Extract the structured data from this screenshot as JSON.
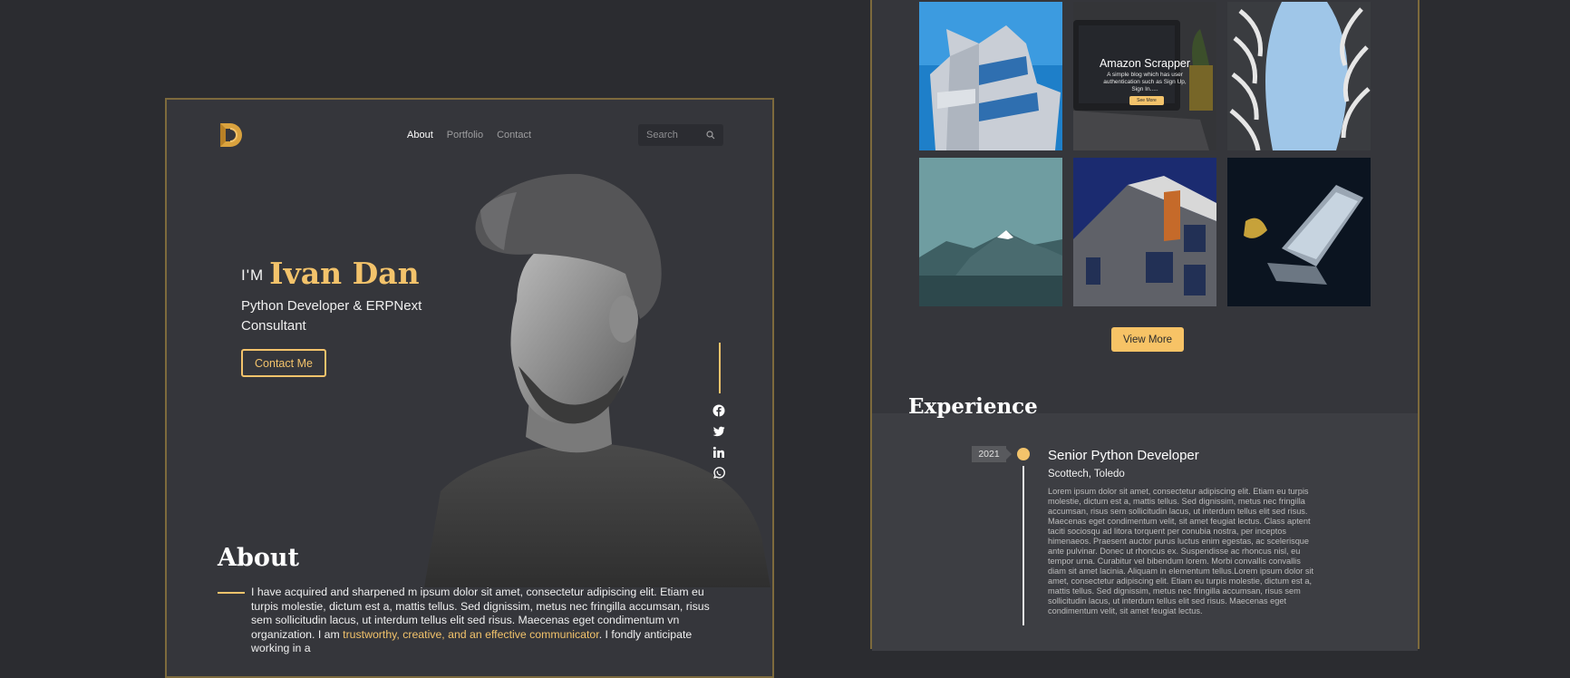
{
  "header": {
    "nav": [
      {
        "label": "About",
        "active": true
      },
      {
        "label": "Portfolio",
        "active": false
      },
      {
        "label": "Contact",
        "active": false
      }
    ],
    "search": {
      "placeholder": "Search"
    }
  },
  "hero": {
    "prefix": "I'M",
    "name": "Ivan Dan",
    "role": "Python Developer & ERPNext Consultant",
    "contact_button": "Contact Me",
    "social": [
      "facebook-icon",
      "twitter-icon",
      "linkedin-icon",
      "whatsapp-icon"
    ]
  },
  "about": {
    "title": "About",
    "text_before": "I have acquired and sharpened m ipsum dolor sit amet, consectetur adipiscing elit. Etiam eu turpis molestie, dictum est a, mattis tellus. Sed dignissim, metus nec fringilla accumsan, risus sem sollicitudin lacus, ut interdum tellus elit sed risus. Maecenas eget condimentum vn organization. I am ",
    "highlight": "trustworthy, creative, and an effective communicator",
    "text_after": ". I fondly anticipate working in a"
  },
  "portfolio": {
    "featured": {
      "title": "Amazon Scrapper",
      "description": "A simple blog which has user authentication such as Sign Up, Sign In.....",
      "button": "See More"
    },
    "view_more": "View More"
  },
  "experience": {
    "title": "Experience",
    "items": [
      {
        "year": "2021",
        "title": "Senior Python Developer",
        "company": "Scottech, Toledo",
        "description": "Lorem ipsum dolor sit amet, consectetur adipiscing elit. Etiam eu turpis molestie, dictum est a, mattis tellus. Sed dignissim, metus nec fringilla accumsan, risus sem sollicitudin lacus, ut interdum tellus elit sed risus. Maecenas eget condimentum velit, sit amet feugiat lectus. Class aptent taciti sociosqu ad litora torquent per conubia nostra, per inceptos himenaeos. Praesent auctor purus luctus enim egestas, ac scelerisque ante pulvinar. Donec ut rhoncus ex. Suspendisse ac rhoncus nisl, eu tempor urna. Curabitur vel bibendum lorem. Morbi convallis convallis diam sit amet lacinia. Aliquam in elementum tellus.Lorem ipsum dolor sit amet, consectetur adipiscing elit. Etiam eu turpis molestie, dictum est a, mattis tellus. Sed dignissim, metus nec fringilla accumsan, risus sem sollicitudin lacus, ut interdum tellus elit sed risus. Maecenas eget condimentum velit, sit amet feugiat lectus."
      }
    ]
  },
  "colors": {
    "accent": "#f3c36b",
    "background": "#2b2c30",
    "card": "#35363b",
    "card_border": "#7d6a3c"
  }
}
